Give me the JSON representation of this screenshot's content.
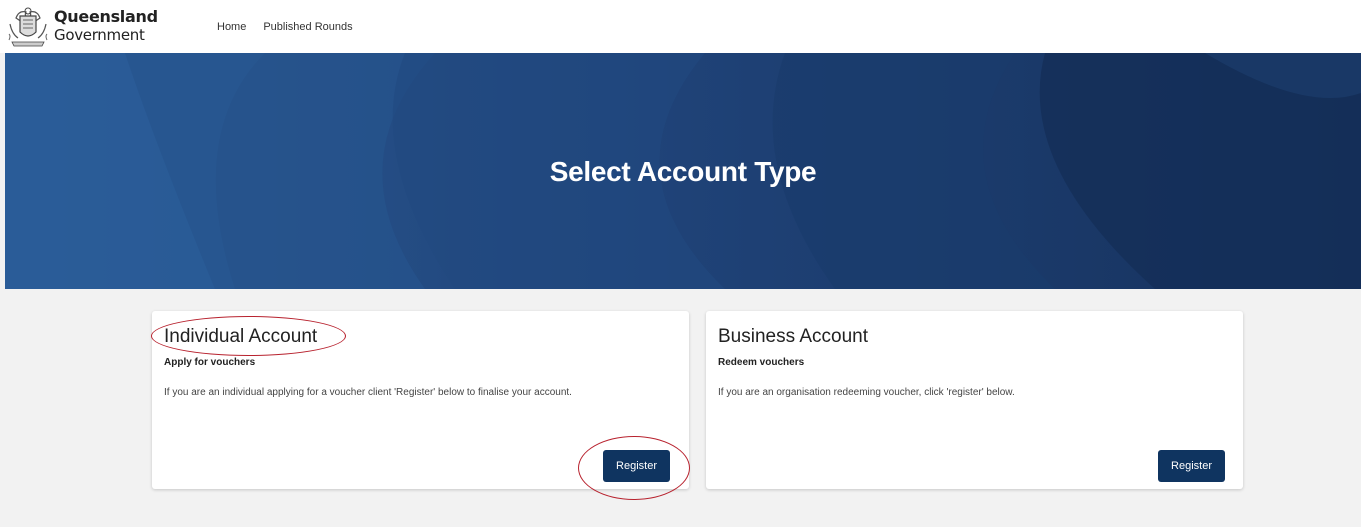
{
  "header": {
    "brand_line1": "Queensland",
    "brand_line2": "Government",
    "nav": [
      {
        "label": "Home"
      },
      {
        "label": "Published Rounds"
      }
    ]
  },
  "hero": {
    "title": "Select Account Type"
  },
  "cards": [
    {
      "title": "Individual Account",
      "subtitle": "Apply for vouchers",
      "description": "If you are an individual applying for a voucher client 'Register' below to finalise your account.",
      "button_label": "Register"
    },
    {
      "title": "Business Account",
      "subtitle": "Redeem vouchers",
      "description": "If you are an organisation redeeming voucher, click 'register' below.",
      "button_label": "Register"
    }
  ],
  "colors": {
    "hero_background": "#1e3f70",
    "button_background": "#0f3460",
    "annotation": "#b8232f",
    "page_background": "#f2f2f2"
  }
}
